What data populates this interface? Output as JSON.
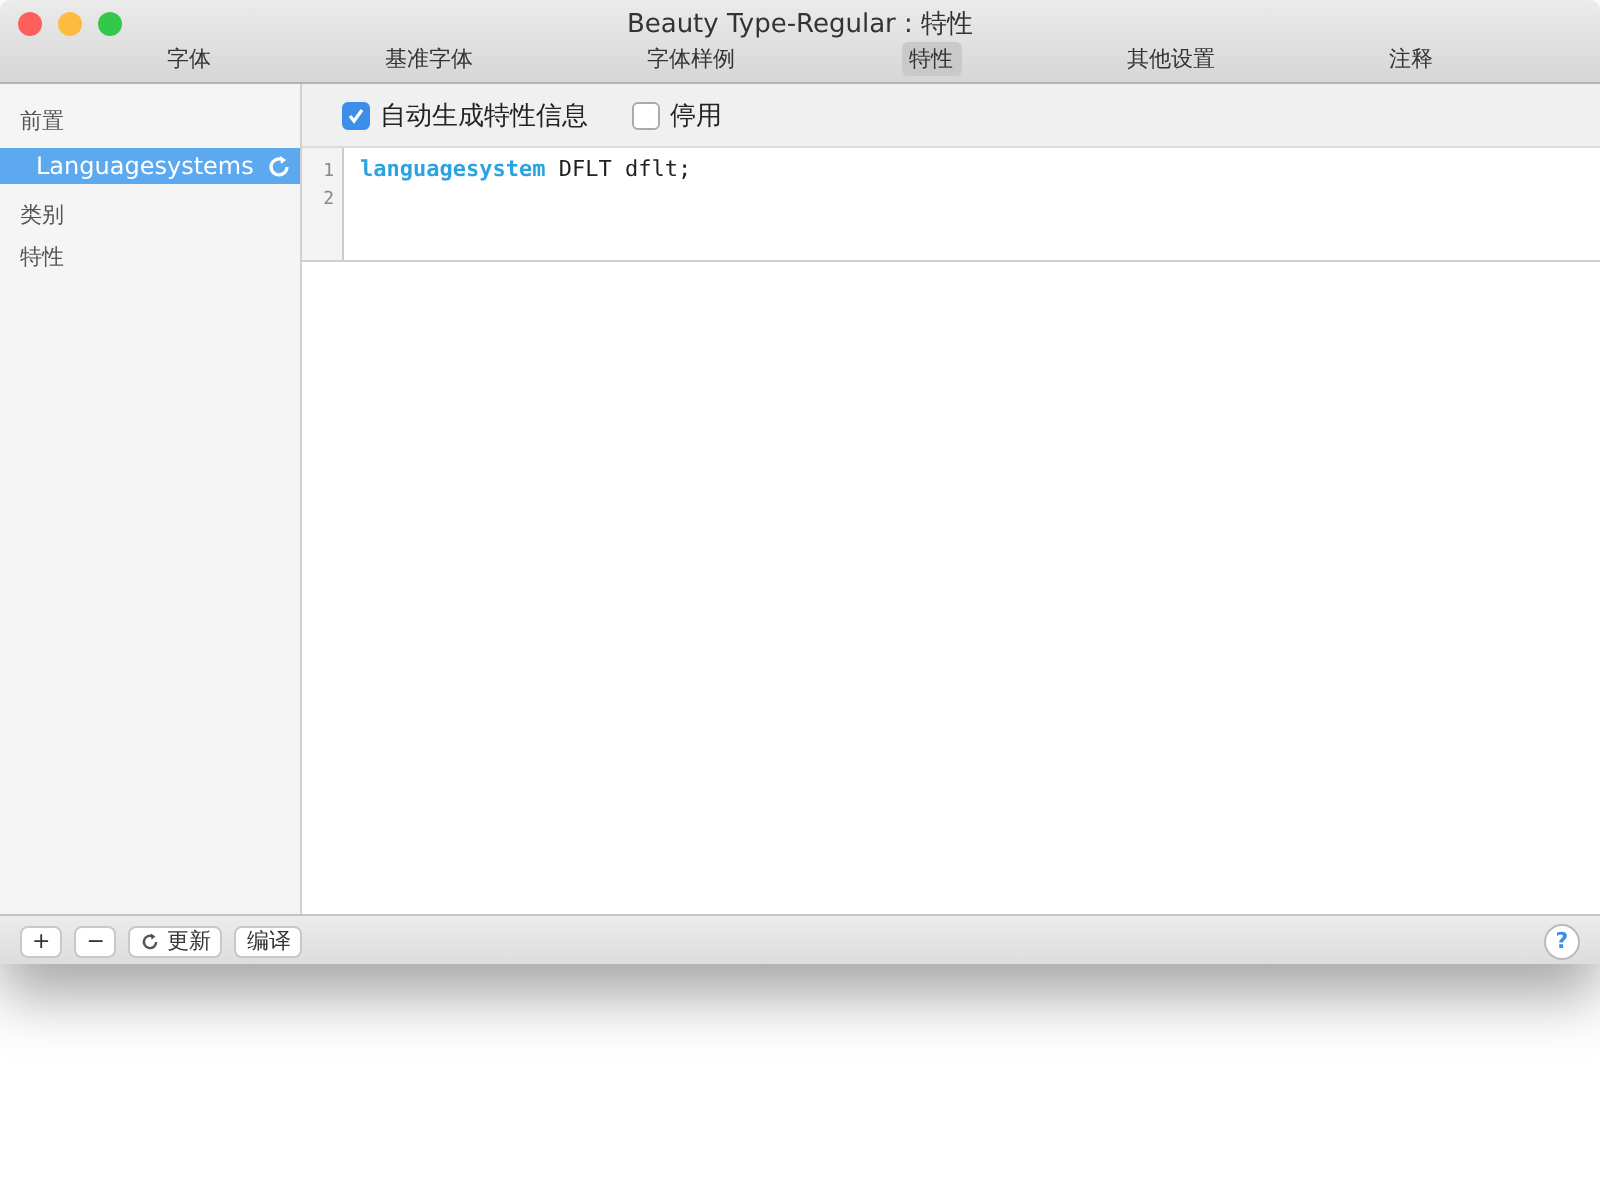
{
  "window": {
    "title": "Beauty Type-Regular : 特性"
  },
  "tabs": [
    {
      "label": "字体",
      "selected": false
    },
    {
      "label": "基准字体",
      "selected": false
    },
    {
      "label": "字体样例",
      "selected": false
    },
    {
      "label": "特性",
      "selected": true
    },
    {
      "label": "其他设置",
      "selected": false
    },
    {
      "label": "注释",
      "selected": false
    }
  ],
  "sidebar": {
    "sections": [
      {
        "title": "前置",
        "items": [
          {
            "label": "Languagesystems",
            "selected": true
          }
        ]
      },
      {
        "title": "类别"
      },
      {
        "title": "特性"
      }
    ]
  },
  "options": [
    {
      "label": "自动生成特性信息",
      "checked": true
    },
    {
      "label": "停用",
      "checked": false
    }
  ],
  "code": {
    "lines": [
      {
        "number": "1",
        "tokens": [
          {
            "kind": "keyword",
            "text": "languagesystem"
          },
          {
            "kind": "plain",
            "text": " DFLT dflt;"
          }
        ]
      },
      {
        "number": "2"
      }
    ]
  },
  "bottom_bar": {
    "buttons": [
      {
        "label": "+",
        "kind": "icon"
      },
      {
        "label": "−",
        "kind": "icon"
      },
      {
        "label": "更新",
        "kind": "refresh"
      },
      {
        "label": "编译",
        "kind": "text"
      }
    ],
    "help": "?"
  }
}
